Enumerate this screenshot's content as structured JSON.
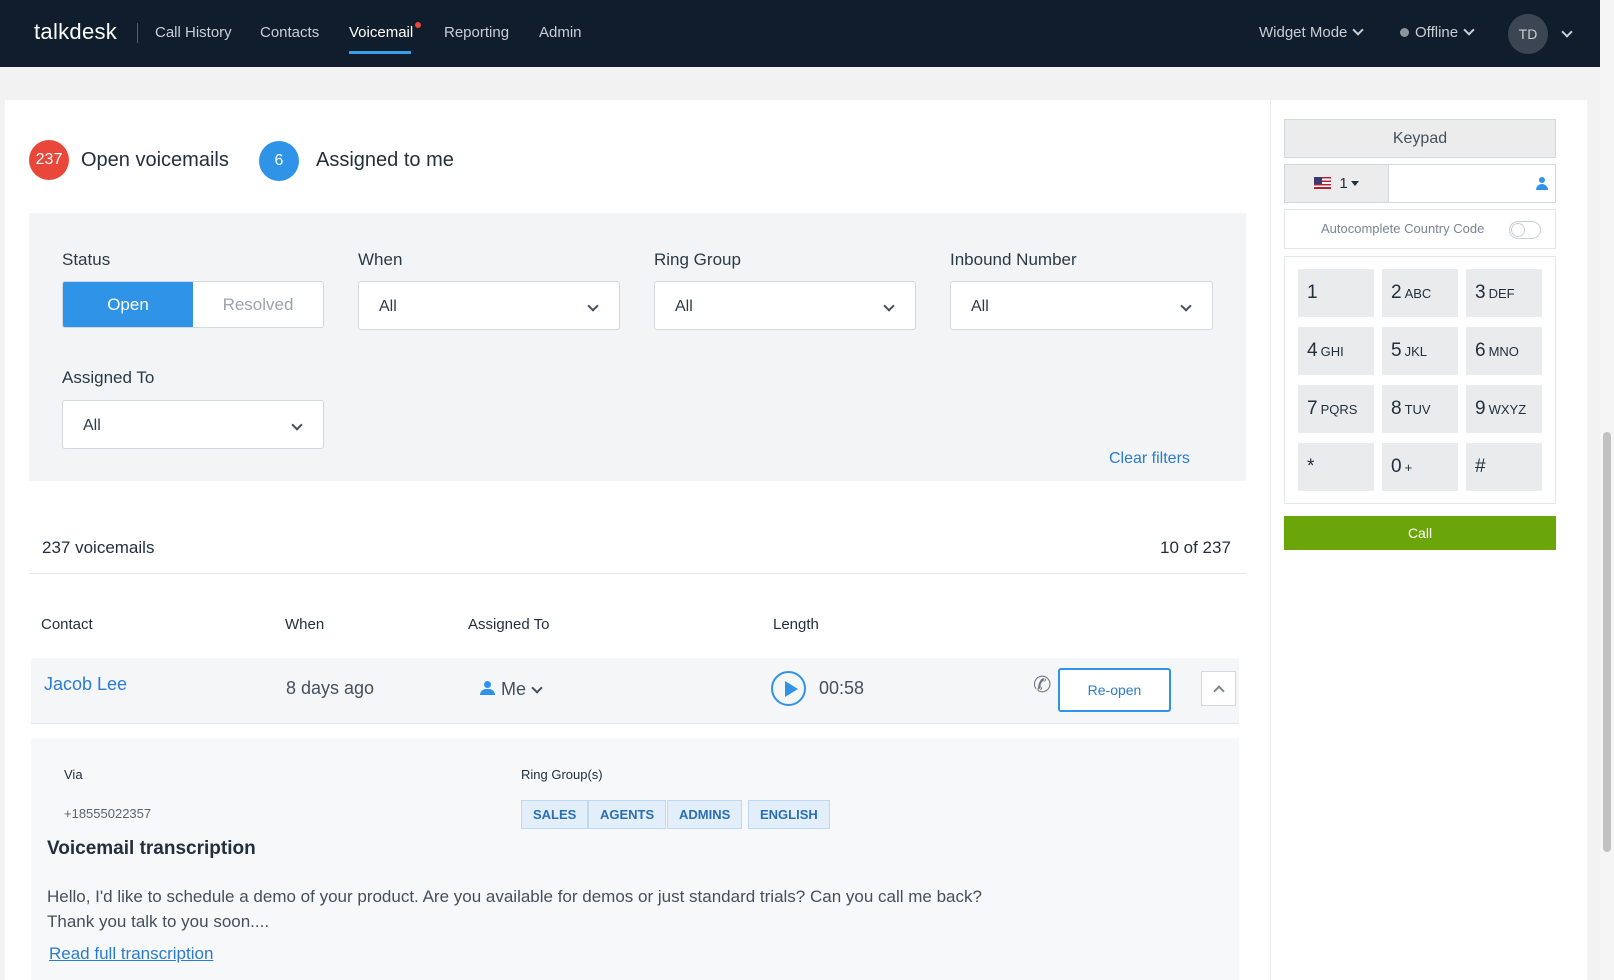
{
  "nav": {
    "logo": "talkdesk",
    "items": [
      "Call History",
      "Contacts",
      "Voicemail",
      "Reporting",
      "Admin"
    ],
    "widget_mode": "Widget Mode",
    "status": "Offline",
    "avatar": "TD"
  },
  "summary": {
    "open_count": "237",
    "open_label": "Open voicemails",
    "assigned_count": "6",
    "assigned_label": "Assigned to me",
    "open_color": "#e8473a",
    "assigned_color": "#2f93e8"
  },
  "filters": {
    "status_label": "Status",
    "status_open": "Open",
    "status_resolved": "Resolved",
    "when_label": "When",
    "when_value": "All",
    "ring_group_label": "Ring Group",
    "ring_group_value": "All",
    "inbound_label": "Inbound Number",
    "inbound_value": "All",
    "assigned_label": "Assigned To",
    "assigned_value": "All",
    "clear": "Clear filters"
  },
  "list": {
    "count": "237 voicemails",
    "paging": "10 of 237",
    "columns": [
      "Contact",
      "When",
      "Assigned To",
      "Length"
    ],
    "row": {
      "contact": "Jacob Lee",
      "when": "8 days ago",
      "assigned": "Me",
      "length": "00:58",
      "action": "Re-open"
    },
    "detail": {
      "via_label": "Via",
      "via_value": "+18555022357",
      "ring_groups_label": "Ring Group(s)",
      "ring_groups": [
        "SALES",
        "AGENTS",
        "ADMINS",
        "ENGLISH"
      ],
      "transcription_title": "Voicemail transcription",
      "transcription_line1": "Hello, I'd like to schedule a demo of your product. Are you available for demos or just standard trials? Can you call me back?",
      "transcription_line2": "Thank you talk to you soon....",
      "read_full": "Read full transcription"
    }
  },
  "dialer": {
    "title": "Keypad",
    "country_code": "1",
    "autocomplete": "Autocomplete Country Code",
    "keys": [
      {
        "d": "1",
        "l": ""
      },
      {
        "d": "2",
        "l": "ABC"
      },
      {
        "d": "3",
        "l": "DEF"
      },
      {
        "d": "4",
        "l": "GHI"
      },
      {
        "d": "5",
        "l": "JKL"
      },
      {
        "d": "6",
        "l": "MNO"
      },
      {
        "d": "7",
        "l": "PQRS"
      },
      {
        "d": "8",
        "l": "TUV"
      },
      {
        "d": "9",
        "l": "WXYZ"
      },
      {
        "d": "*",
        "l": ""
      },
      {
        "d": "0",
        "l": "+"
      },
      {
        "d": "#",
        "l": ""
      }
    ],
    "call": "Call",
    "call_color": "#6aa509"
  }
}
